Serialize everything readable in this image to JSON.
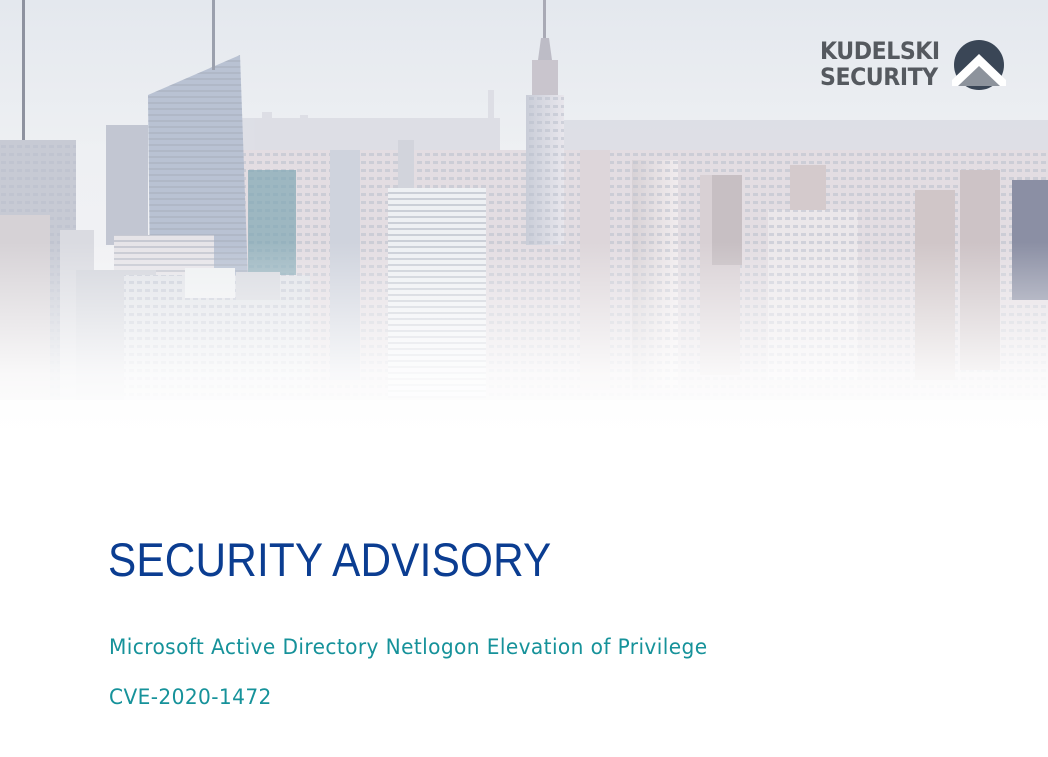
{
  "header": {
    "logo": {
      "line1": "KUDELSKI",
      "line2": "SECURITY",
      "mark": "mountain-circle-logo"
    },
    "image": {
      "subject": "city-skyline-photo"
    }
  },
  "document": {
    "title": "SECURITY ADVISORY",
    "subtitle": "Microsoft Active Directory Netlogon Elevation of Privilege",
    "cve": "CVE-2020-1472"
  },
  "colors": {
    "title": "#0b3d91",
    "subtitle": "#16929a",
    "logo": "#55595f",
    "sky": "#dfe6ef"
  }
}
